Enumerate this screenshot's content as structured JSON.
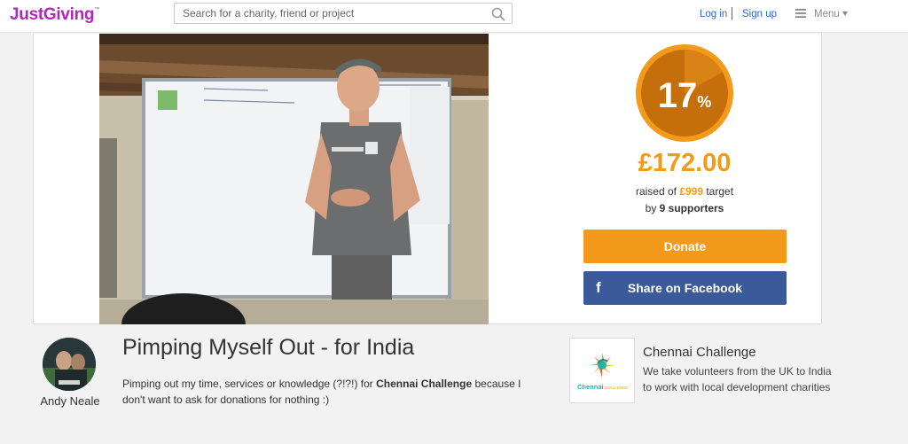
{
  "header": {
    "logo_text": "JustGiving",
    "logo_tm": "™",
    "search_placeholder": "Search for a charity, friend or project",
    "login_label": "Log in",
    "signup_label": "Sign up",
    "menu_label": "Menu"
  },
  "fundraising": {
    "percent": "17",
    "percent_symbol": "%",
    "progress_fraction": 0.17,
    "amount_raised": "£172.00",
    "raised_prefix": "raised of ",
    "target": "£999",
    "target_suffix": " target",
    "supporters_prefix": "by ",
    "supporters_count": "9 supporters",
    "donate_label": "Donate",
    "share_label": "Share on Facebook",
    "facebook_icon": "f"
  },
  "page": {
    "owner_name": "Andy Neale",
    "title": "Pimping Myself Out - for India",
    "story_prefix": "Pimping out my time, services or knowledge (?!?!) for ",
    "story_charity": "Chennai Challenge",
    "story_suffix": " because I don't want to ask for donations for nothing :)"
  },
  "charity": {
    "name": "Chennai Challenge",
    "description": "We take volunteers from the UK to India to work with local development charities",
    "logo_text_1": "Chennai",
    "logo_text_2": "CHALLENGE"
  },
  "colors": {
    "brand": "#ad29b6",
    "accent": "#f39a1b",
    "facebook": "#3b5a9a",
    "link": "#2a69c9"
  },
  "icons": [
    "search-icon",
    "hamburger-menu-icon",
    "caret-down-icon",
    "facebook-icon"
  ]
}
